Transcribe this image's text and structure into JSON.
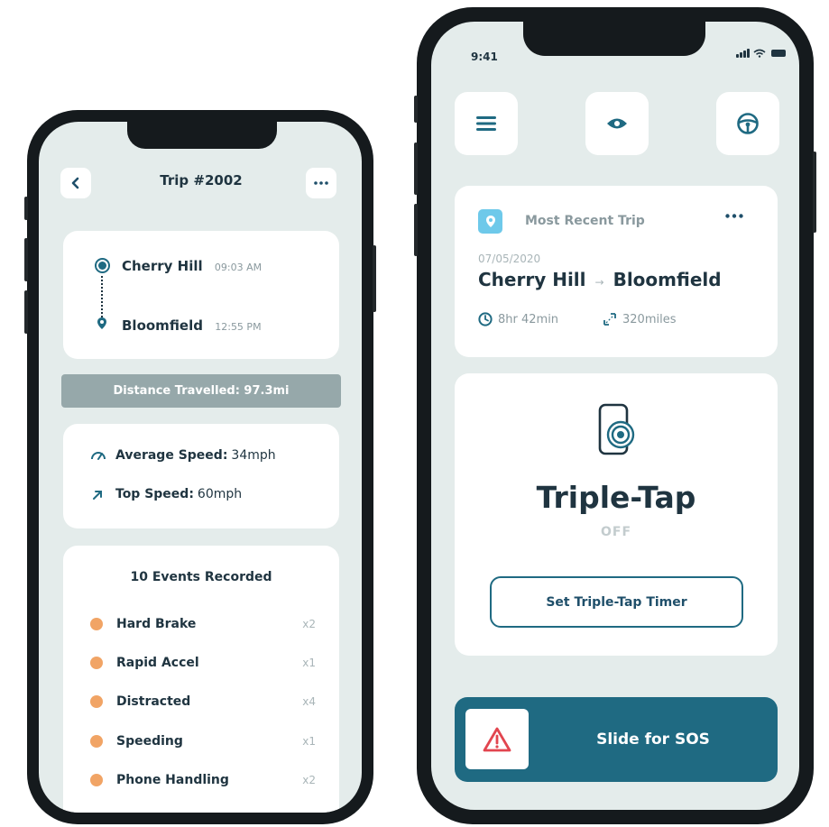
{
  "trip_detail": {
    "title": "Trip #2002",
    "route": {
      "origin": {
        "name": "Cherry Hill",
        "time": "09:03 AM"
      },
      "destination": {
        "name": "Bloomfield",
        "time": "12:55 PM"
      }
    },
    "distance_label": "Distance Travelled: 97.3mi",
    "average_speed": {
      "label": "Average Speed:",
      "value": "34mph"
    },
    "top_speed": {
      "label": "Top Speed:",
      "value": "60mph"
    },
    "events_title": "10 Events Recorded",
    "events": [
      {
        "label": "Hard Brake",
        "count": "x2"
      },
      {
        "label": "Rapid Accel",
        "count": "x1"
      },
      {
        "label": "Distracted",
        "count": "x4"
      },
      {
        "label": "Speeding",
        "count": "x1"
      },
      {
        "label": "Phone Handling",
        "count": "x2"
      }
    ],
    "event_color": "#f1a465"
  },
  "home": {
    "status_time": "9:41",
    "toolbar": [
      "menu-icon",
      "eye-icon",
      "steering-wheel-icon"
    ],
    "recent_trip": {
      "label": "Most Recent Trip",
      "date": "07/05/2020",
      "from": "Cherry Hill",
      "to": "Bloomfield",
      "duration": "8hr 42min",
      "distance": "320miles"
    },
    "triple_tap": {
      "title": "Triple-Tap",
      "state": "OFF",
      "timer_button": "Set Triple-Tap Timer"
    },
    "sos_label": "Slide for SOS"
  },
  "colors": {
    "primary": "#1f6a82",
    "text": "#1f3440",
    "screen_bg": "#e4eceb",
    "pin": "#6ec9ea",
    "warning": "#e2454f"
  }
}
